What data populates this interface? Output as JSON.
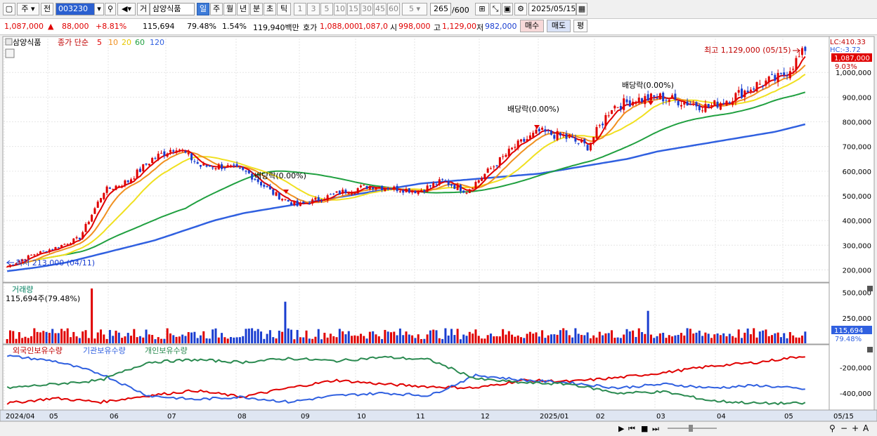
{
  "toolbar": {
    "market": "주",
    "prev": "전",
    "code": "003230",
    "trade": "거",
    "stock_name": "삼양식품",
    "periods": [
      "일",
      "주",
      "월",
      "년",
      "분",
      "초",
      "틱"
    ],
    "active_period": "일",
    "intervals": [
      "1",
      "3",
      "5",
      "10",
      "15",
      "30",
      "45",
      "60"
    ],
    "interval_select": "5",
    "bars": "265",
    "bars_max": "/600",
    "date": "2025/05/15"
  },
  "quote": {
    "price": "1,087,000",
    "change_arrow": "▲",
    "change": "88,000",
    "change_pct": "+8.81%",
    "volume": "115,694",
    "vol_ratio": "79.48%",
    "turnover": "1.54%",
    "amount": "119,940백만",
    "ask_label": "호가",
    "ask": "1,088,000",
    "bid": "1,087,0",
    "open_label": "시",
    "open": "998,000",
    "high_label": "고",
    "high": "1,129,00",
    "low_label": "저",
    "low": "982,000",
    "buy": "매수",
    "sell": "매도",
    "eval": "평"
  },
  "legend": {
    "name": "삼양식품",
    "ma_label": "종가 단순",
    "ma": [
      "5",
      "10",
      "20",
      "60",
      "120"
    ]
  },
  "annotations": {
    "high_label": "최고 1,129,000 (05/15)",
    "low_label": "최저 213,000 (04/11)",
    "div1": "배당락(0.00%)",
    "div2": "배당락(0.00%)",
    "div3": "배당락(0.00%)",
    "lc": "LC:410.33",
    "hc": "HC:-3.72",
    "price_tag": "1,087,000",
    "pct_tag": "9.03%"
  },
  "volume_pane": {
    "title": "거래량",
    "value": "115,694주(79.48%)",
    "tag_value": "115,694",
    "tag_pct": "79.48%"
  },
  "holding_pane": {
    "legend": [
      "외국인보유수량",
      "기관보유수량",
      "개인보유수량"
    ]
  },
  "colors": {
    "ma5": "#e00000",
    "ma10": "#f09020",
    "ma20": "#f0e020",
    "ma60": "#20a040",
    "ma120": "#3060e0",
    "up": "#e00000",
    "down": "#1a3ed0",
    "foreign": "#e00000",
    "inst": "#3060e0",
    "indiv": "#2a8a50"
  },
  "chart_data": [
    {
      "type": "candlestick",
      "title": "삼양식품",
      "x_ticks": [
        "2024/04",
        "05",
        "06",
        "07",
        "08",
        "09",
        "10",
        "11",
        "12",
        "2025/01",
        "02",
        "03",
        "04",
        "05",
        "05/15"
      ],
      "y_ticks": [
        200000,
        300000,
        400000,
        500000,
        600000,
        700000,
        800000,
        900000,
        1000000
      ],
      "ylim": [
        150000,
        1140000
      ],
      "series": [
        {
          "name": "5",
          "values": [
            213000,
            260000,
            290000,
            330000,
            520000,
            560000,
            650000,
            700000,
            620000,
            620000,
            590000,
            510000,
            460000,
            490000,
            520000,
            540000,
            530000,
            520000,
            560000,
            520000,
            610000,
            700000,
            760000,
            740000,
            700000,
            860000,
            890000,
            900000,
            880000,
            860000,
            900000,
            950000,
            980000,
            1087000
          ]
        },
        {
          "name": "120",
          "values": [
            195000,
            210000,
            230000,
            260000,
            290000,
            320000,
            360000,
            400000,
            430000,
            450000,
            470000,
            490000,
            510000,
            530000,
            550000,
            560000,
            570000,
            580000,
            590000,
            610000,
            630000,
            650000,
            680000,
            700000,
            720000,
            740000,
            760000,
            790000
          ]
        }
      ],
      "high": {
        "date": "05/15",
        "value": 1129000
      },
      "low": {
        "date": "04/11",
        "value": 213000
      }
    },
    {
      "type": "bar",
      "title": "거래량",
      "y_ticks": [
        250000,
        500000
      ],
      "last": 115694
    },
    {
      "type": "line",
      "series": [
        {
          "name": "외국인보유수량"
        },
        {
          "name": "기관보유수량"
        },
        {
          "name": "개인보유수량"
        }
      ],
      "y_ticks": [
        -200000,
        -400000
      ]
    }
  ]
}
